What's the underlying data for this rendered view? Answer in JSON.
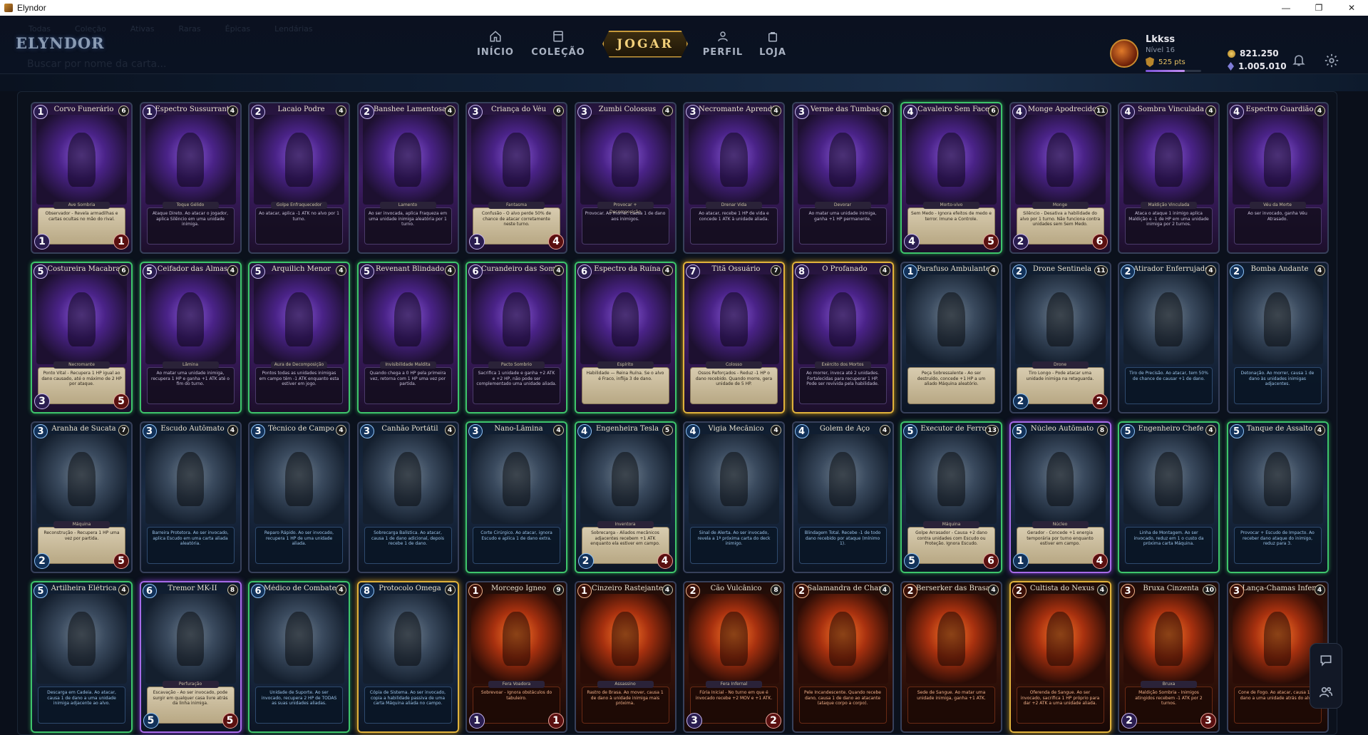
{
  "window": {
    "title": "Elyndor",
    "buttons": [
      "—",
      "❐",
      "✕"
    ]
  },
  "logo": "ELYNDOR",
  "ghost_tabs": [
    "Todas",
    "Coleção",
    "Ativas",
    "Raras",
    "Épicas",
    "Lendárias"
  ],
  "ghost_search": "Buscar por nome da carta...",
  "nav": {
    "home": "INÍCIO",
    "collection": "COLEÇÃO",
    "play": "JOGAR",
    "profile": "PERFIL",
    "shop": "LOJA"
  },
  "user": {
    "name": "Lkkss",
    "level": "Nível 16",
    "points": "525 pts",
    "xp_fraction": 0.7
  },
  "currency": {
    "gold": "821.250",
    "gems": "1.005.010"
  },
  "colors": {
    "accent_gold": "#e0b23c",
    "rarity_green": "#3ec46b",
    "rarity_purple": "#a76be8"
  },
  "cards": [
    {
      "name": "Corvo Funerário",
      "cost": "1",
      "qty": "6",
      "faction": "undead",
      "rarity": "",
      "type": "Ave Sombria",
      "text": "Observador - Revela armadilhas e cartas ocultas no mão do rival.",
      "atk": "1",
      "hp": "1",
      "parch": true
    },
    {
      "name": "Espectro Sussurrante",
      "cost": "1",
      "qty": "4",
      "faction": "undead",
      "rarity": "",
      "type": "Toque Gélido",
      "text": "Ataque Direto. Ao atacar o jogador, aplica Silêncio em uma unidade inimiga.",
      "atk": "",
      "hp": "",
      "parch": false
    },
    {
      "name": "Lacaio Podre",
      "cost": "2",
      "qty": "4",
      "faction": "undead",
      "rarity": "",
      "type": "Golpe Enfraquecedor",
      "text": "Ao atacar, aplica -1 ATK no alvo por 1 turno.",
      "atk": "",
      "hp": "",
      "parch": false
    },
    {
      "name": "Banshee Lamentosa",
      "cost": "2",
      "qty": "4",
      "faction": "undead",
      "rarity": "",
      "type": "Lamento",
      "text": "Ao ser invocada, aplica Fraqueza em uma unidade inimiga aleatória por 1 turno.",
      "atk": "",
      "hp": "",
      "parch": false
    },
    {
      "name": "Criança do Véu",
      "cost": "3",
      "qty": "6",
      "faction": "undead",
      "rarity": "",
      "type": "Fantasma",
      "text": "Confusão - O alvo perde 50% de chance de atacar corretamente neste turno.",
      "atk": "1",
      "hp": "4",
      "parch": true
    },
    {
      "name": "Zumbi Colossus",
      "cost": "3",
      "qty": "4",
      "faction": "undead",
      "rarity": "",
      "type": "Provocar + Decomposição",
      "text": "Provocar. Ao morrer, causa 1 de dano aos inimigos.",
      "atk": "",
      "hp": "",
      "parch": false
    },
    {
      "name": "Necromante Aprendiz",
      "cost": "3",
      "qty": "4",
      "faction": "undead",
      "rarity": "",
      "type": "Drenar Vida",
      "text": "Ao atacar, recebe 1 HP de vida e concede 1 ATK à unidade aliada.",
      "atk": "",
      "hp": "",
      "parch": false
    },
    {
      "name": "Verme das Tumbas",
      "cost": "3",
      "qty": "4",
      "faction": "undead",
      "rarity": "",
      "type": "Devorar",
      "text": "Ao matar uma unidade inimiga, ganha +1 HP permanente.",
      "atk": "",
      "hp": "",
      "parch": false
    },
    {
      "name": "Cavaleiro Sem Face",
      "cost": "4",
      "qty": "6",
      "faction": "undead",
      "rarity": "green",
      "type": "Morto-vivo",
      "text": "Sem Medo - Ignora efeitos de medo e terror. Imune a Controle.",
      "atk": "4",
      "hp": "5",
      "parch": true
    },
    {
      "name": "Monge Apodrecido",
      "cost": "4",
      "qty": "11",
      "faction": "undead",
      "rarity": "",
      "type": "Monge",
      "text": "Silêncio - Desativa a habilidade do alvo por 1 turno. Não funciona contra unidades sem Sem Medo.",
      "atk": "2",
      "hp": "6",
      "parch": true
    },
    {
      "name": "Sombra Vinculada",
      "cost": "4",
      "qty": "4",
      "faction": "undead",
      "rarity": "",
      "type": "Maldição Vinculada",
      "text": "Ataca o ataque 1 inimigo aplica Maldição e -1 de HP em uma unidade inimiga por 2 turnos.",
      "atk": "",
      "hp": "",
      "parch": false
    },
    {
      "name": "Espectro Guardião",
      "cost": "4",
      "qty": "4",
      "faction": "undead",
      "rarity": "",
      "type": "Véu da Morte",
      "text": "Ao ser invocado, ganha Véu Atrasado.",
      "atk": "",
      "hp": "",
      "parch": false
    },
    {
      "name": "Costureira Macabra",
      "cost": "5",
      "qty": "6",
      "faction": "undead",
      "rarity": "green",
      "type": "Necromante",
      "text": "Ponto Vital - Recupera 1 HP igual ao dano causado, até o máximo de 2 HP por ataque.",
      "atk": "3",
      "hp": "5",
      "parch": true
    },
    {
      "name": "Ceifador das Almas",
      "cost": "5",
      "qty": "4",
      "faction": "undead",
      "rarity": "green",
      "type": "Lâmina",
      "text": "Ao matar uma unidade inimiga, recupera 1 HP e ganha +1 ATK até o fim do turno.",
      "atk": "",
      "hp": "",
      "parch": false
    },
    {
      "name": "Arquilich Menor",
      "cost": "5",
      "qty": "4",
      "faction": "undead",
      "rarity": "green",
      "type": "Aura de Decomposição",
      "text": "Pontos todas as unidades inimigas em campo têm -1 ATK enquanto esta estiver em jogo.",
      "atk": "",
      "hp": "",
      "parch": false
    },
    {
      "name": "Revenant Blindado",
      "cost": "5",
      "qty": "4",
      "faction": "undead",
      "rarity": "green",
      "type": "Invisibilidade Maldita",
      "text": "Quando chega a 0 HP pela primeira vez, retorna com 1 HP uma vez por partida.",
      "atk": "",
      "hp": "",
      "parch": false
    },
    {
      "name": "Curandeiro das Sombras",
      "cost": "6",
      "qty": "4",
      "faction": "undead",
      "rarity": "green",
      "type": "Pacto Sombrio",
      "text": "Sacrifica 1 unidade e ganha +2 ATK e +2 HP, não pode ser complementado uma unidade aliada.",
      "atk": "",
      "hp": "",
      "parch": false
    },
    {
      "name": "Espectro da Ruína",
      "cost": "6",
      "qty": "4",
      "faction": "undead",
      "rarity": "green",
      "type": "Espírito",
      "text": "Habilidade — Reina Ruína. Se o alvo é Fraco, inflija 3 de dano.",
      "atk": "",
      "hp": "",
      "parch": true
    },
    {
      "name": "Titã Ossuário",
      "cost": "7",
      "qty": "7",
      "faction": "undead",
      "rarity": "gold",
      "type": "Colosso",
      "text": "Ossos Reforçados - Reduz -1 HP o dano recebido. Quando morre, gera unidade de 5 HP.",
      "atk": "",
      "hp": "",
      "parch": true
    },
    {
      "name": "O Profanado",
      "cost": "8",
      "qty": "4",
      "faction": "undead",
      "rarity": "gold",
      "type": "Exército dos Mortos",
      "text": "Ao morrer, invoca até 2 unidades. Fortalecidas para recuperar 1 HP. Pode ser revivida pela habilidade.",
      "atk": "",
      "hp": "",
      "parch": false
    },
    {
      "name": "Parafuso Ambulante",
      "cost": "1",
      "qty": "4",
      "faction": "mech",
      "rarity": "",
      "type": "",
      "text": "Peça Sobressalente - Ao ser destruído, concede +1 HP a um aliado Máquina aleatório.",
      "atk": "",
      "hp": "",
      "parch": true
    },
    {
      "name": "Drone Sentinela",
      "cost": "2",
      "qty": "11",
      "faction": "mech",
      "rarity": "",
      "type": "Drone",
      "text": "Tiro Longo - Pode atacar uma unidade inimiga na retaguarda.",
      "atk": "2",
      "hp": "2",
      "parch": true
    },
    {
      "name": "Atirador Enferrujado",
      "cost": "2",
      "qty": "4",
      "faction": "mech",
      "rarity": "",
      "type": "",
      "text": "Tiro de Precisão. Ao atacar, tem 50% de chance de causar +1 de dano.",
      "atk": "",
      "hp": "",
      "parch": false
    },
    {
      "name": "Bomba Andante",
      "cost": "2",
      "qty": "4",
      "faction": "mech",
      "rarity": "",
      "type": "",
      "text": "Detonação. Ao morrer, causa 1 de dano às unidades inimigas adjacentes.",
      "atk": "",
      "hp": "",
      "parch": false
    },
    {
      "name": "Aranha de Sucata",
      "cost": "3",
      "qty": "7",
      "faction": "mech",
      "rarity": "",
      "type": "Máquina",
      "text": "Reconstrução - Recupera 1 HP uma vez por partida.",
      "atk": "2",
      "hp": "5",
      "parch": true
    },
    {
      "name": "Escudo Autômato",
      "cost": "3",
      "qty": "4",
      "faction": "mech",
      "rarity": "",
      "type": "",
      "text": "Barreira Protetora. Ao ser invocado, aplica Escudo em uma carta aliada aleatória.",
      "atk": "",
      "hp": "",
      "parch": false
    },
    {
      "name": "Técnico de Campo",
      "cost": "3",
      "qty": "4",
      "faction": "mech",
      "rarity": "",
      "type": "",
      "text": "Reparo Rápido. Ao ser invocado, recupera 1 HP de uma unidade aliada.",
      "atk": "",
      "hp": "",
      "parch": false
    },
    {
      "name": "Canhão Portátil",
      "cost": "3",
      "qty": "4",
      "faction": "mech",
      "rarity": "",
      "type": "",
      "text": "Sobrecarga Balística. Ao atacar, causa 1 de dano adicional, depois recebe 1 de dano.",
      "atk": "",
      "hp": "",
      "parch": false
    },
    {
      "name": "Nano-Lâmina",
      "cost": "3",
      "qty": "4",
      "faction": "mech",
      "rarity": "green",
      "type": "",
      "text": "Corte Cirúrgico. Ao atacar, ignora Escudo e aplica 1 de dano extra.",
      "atk": "",
      "hp": "",
      "parch": false
    },
    {
      "name": "Engenheira Tesla",
      "cost": "4",
      "qty": "5",
      "faction": "mech",
      "rarity": "green",
      "type": "Inventora",
      "text": "Sobrecarga - Aliados mecânicos adjacentes recebem +1 ATK enquanto ela estiver em campo.",
      "atk": "2",
      "hp": "4",
      "parch": true
    },
    {
      "name": "Vigia Mecânico",
      "cost": "4",
      "qty": "4",
      "faction": "mech",
      "rarity": "",
      "type": "",
      "text": "Sinal de Alerta. Ao ser invocado, revela a 1ª próxima carta do deck inimigo.",
      "atk": "",
      "hp": "",
      "parch": false
    },
    {
      "name": "Golem de Aço",
      "cost": "4",
      "qty": "4",
      "faction": "mech",
      "rarity": "",
      "type": "",
      "text": "Blindagem Total. Recebe -1 de todo dano recebido por ataque (mínimo 1).",
      "atk": "",
      "hp": "",
      "parch": false
    },
    {
      "name": "Executor de Ferro",
      "cost": "5",
      "qty": "13",
      "faction": "mech",
      "rarity": "green",
      "type": "Máquina",
      "text": "Golpe Arrasador - Causa +2 dano contra unidades com Escudo ou Proteção. Ignora Escudo.",
      "atk": "5",
      "hp": "6",
      "parch": true
    },
    {
      "name": "Núcleo Autômato",
      "cost": "5",
      "qty": "8",
      "faction": "mech",
      "rarity": "purple",
      "type": "Núcleo",
      "text": "Gerador - Concede +1 energia temporária por turno enquanto estiver em campo.",
      "atk": "1",
      "hp": "4",
      "parch": true
    },
    {
      "name": "Engenheiro Chefe",
      "cost": "5",
      "qty": "4",
      "faction": "mech",
      "rarity": "green",
      "type": "",
      "text": "Linha de Montagem. Ao ser invocado, reduz em 1 o custo da próxima carta Máquina.",
      "atk": "",
      "hp": "",
      "parch": false
    },
    {
      "name": "Tanque de Assalto",
      "cost": "5",
      "qty": "4",
      "faction": "mech",
      "rarity": "green",
      "type": "",
      "text": "Provocar + Escudo de Impacto. Ao receber dano ataque do inimigo, reduz para 3.",
      "atk": "",
      "hp": "",
      "parch": false
    },
    {
      "name": "Artilheira Elétrica",
      "cost": "5",
      "qty": "4",
      "faction": "mech",
      "rarity": "green",
      "type": "",
      "text": "Descarga em Cadeia. Ao atacar, causa 1 de dano a uma unidade inimiga adjacente ao alvo.",
      "atk": "",
      "hp": "",
      "parch": false
    },
    {
      "name": "Tremor MK-II",
      "cost": "6",
      "qty": "8",
      "faction": "mech",
      "rarity": "purple",
      "type": "Perfuração",
      "text": "Escavação - Ao ser invocado, pode surgir em qualquer casa livre atrás da linha inimiga.",
      "atk": "5",
      "hp": "5",
      "parch": true
    },
    {
      "name": "Médico de Combate MK-I",
      "cost": "6",
      "qty": "4",
      "faction": "mech",
      "rarity": "green",
      "type": "",
      "text": "Unidade de Suporte. Ao ser invocado, recupera 2 HP de TODAS as suas unidades aliadas.",
      "atk": "",
      "hp": "",
      "parch": false
    },
    {
      "name": "Protocolo Ômega",
      "cost": "8",
      "qty": "4",
      "faction": "mech",
      "rarity": "gold",
      "type": "",
      "text": "Cópia de Sistema. Ao ser invocado, copia a habilidade passiva de uma carta Máquina aliada no campo.",
      "atk": "",
      "hp": "",
      "parch": false
    },
    {
      "name": "Morcego Ígneo",
      "cost": "1",
      "qty": "9",
      "faction": "fire",
      "rarity": "",
      "type": "Fera Voadora",
      "text": "Sobrevoar - Ignora obstáculos do tabuleiro.",
      "atk": "1",
      "hp": "1",
      "parch": false
    },
    {
      "name": "Cinzeiro Rastejante",
      "cost": "1",
      "qty": "4",
      "faction": "fire",
      "rarity": "",
      "type": "Assassino",
      "text": "Rastro de Brasa. Ao mover, causa 1 de dano à unidade inimiga mais próxima.",
      "atk": "",
      "hp": "",
      "parch": false
    },
    {
      "name": "Cão Vulcânico",
      "cost": "2",
      "qty": "8",
      "faction": "fire",
      "rarity": "",
      "type": "Fera Infernal",
      "text": "Fúria Inicial - No turno em que é invocado recebe +2 MOV e +1 ATK.",
      "atk": "3",
      "hp": "2",
      "parch": false
    },
    {
      "name": "Salamandra de Chamas",
      "cost": "2",
      "qty": "4",
      "faction": "fire",
      "rarity": "",
      "type": "",
      "text": "Pele Incandescente. Quando recebe dano, causa 1 de dano ao atacante (ataque corpo a corpo).",
      "atk": "",
      "hp": "",
      "parch": false
    },
    {
      "name": "Berserker das Brasas",
      "cost": "2",
      "qty": "4",
      "faction": "fire",
      "rarity": "",
      "type": "",
      "text": "Sede de Sangue. Ao matar uma unidade inimiga, ganha +1 ATK.",
      "atk": "",
      "hp": "",
      "parch": false
    },
    {
      "name": "Cultista do Nexus",
      "cost": "2",
      "qty": "4",
      "faction": "fire",
      "rarity": "gold",
      "type": "",
      "text": "Oferenda de Sangue. Ao ser invocado, sacrifica 1 HP próprio para dar +2 ATK a uma unidade aliada.",
      "atk": "",
      "hp": "",
      "parch": false
    },
    {
      "name": "Bruxa Cinzenta",
      "cost": "3",
      "qty": "10",
      "faction": "fire",
      "rarity": "",
      "type": "Bruxa",
      "text": "Maldição Sombria - Inimigos atingidos recebem -1 ATK por 2 turnos.",
      "atk": "2",
      "hp": "3",
      "parch": false
    },
    {
      "name": "Lança-Chamas Infernal",
      "cost": "3",
      "qty": "4",
      "faction": "fire",
      "rarity": "",
      "type": "",
      "text": "Cone de Fogo. Ao atacar, causa 1 de dano a uma unidade atrás do alvo.",
      "atk": "",
      "hp": "",
      "parch": false
    }
  ]
}
